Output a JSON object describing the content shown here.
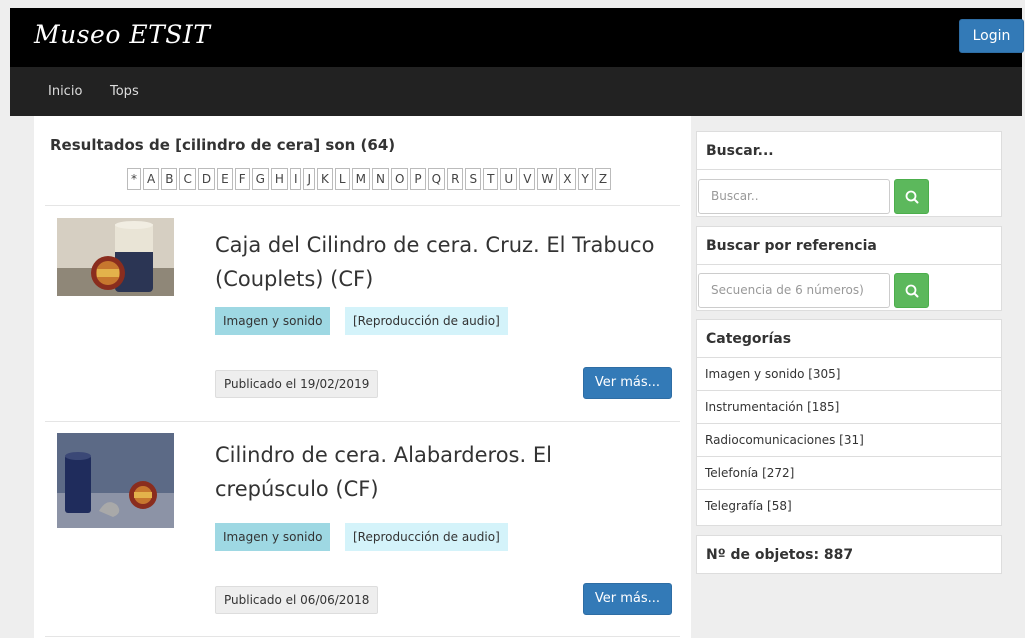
{
  "header": {
    "brand": "Museo ETSIT",
    "login_label": "Login"
  },
  "nav": {
    "items": [
      {
        "label": "Inicio"
      },
      {
        "label": "Tops"
      }
    ]
  },
  "results": {
    "title": "Resultados de [cilindro de cera] son (64)",
    "alphabet": [
      "*",
      "A",
      "B",
      "C",
      "D",
      "E",
      "F",
      "G",
      "H",
      "I",
      "J",
      "K",
      "L",
      "M",
      "N",
      "O",
      "P",
      "Q",
      "R",
      "S",
      "T",
      "U",
      "V",
      "W",
      "X",
      "Y",
      "Z"
    ],
    "items": [
      {
        "title": "Caja del Cilindro de cera. Cruz. El Trabuco (Couplets) (CF)",
        "category": "Imagen y sonido",
        "type": "[Reproducción de audio]",
        "published": "Publicado el 19/02/2019",
        "more_label": "Ver más..."
      },
      {
        "title": "Cilindro de cera. Alabarderos. El crepúsculo (CF)",
        "category": "Imagen y sonido",
        "type": "[Reproducción de audio]",
        "published": "Publicado el 06/06/2018",
        "more_label": "Ver más..."
      }
    ]
  },
  "sidebar": {
    "search": {
      "heading": "Buscar...",
      "placeholder": "Buscar.."
    },
    "ref_search": {
      "heading": "Buscar por referencia",
      "placeholder": "Secuencia de 6 números)"
    },
    "categories": {
      "heading": "Categorías",
      "items": [
        {
          "label": "Imagen y sonido  [305]"
        },
        {
          "label": "Instrumentación  [185]"
        },
        {
          "label": "Radiocomunicaciones  [31]"
        },
        {
          "label": "Telefonía  [272]"
        },
        {
          "label": "Telegrafía  [58]"
        }
      ]
    },
    "object_count": "Nº de objetos:  887"
  },
  "colors": {
    "topbar": "#000000",
    "navbar": "#222222",
    "primary": "#337ab7",
    "success": "#5cb85c",
    "tag_category": "#9ed8e3",
    "tag_type": "#d4f3fa"
  }
}
